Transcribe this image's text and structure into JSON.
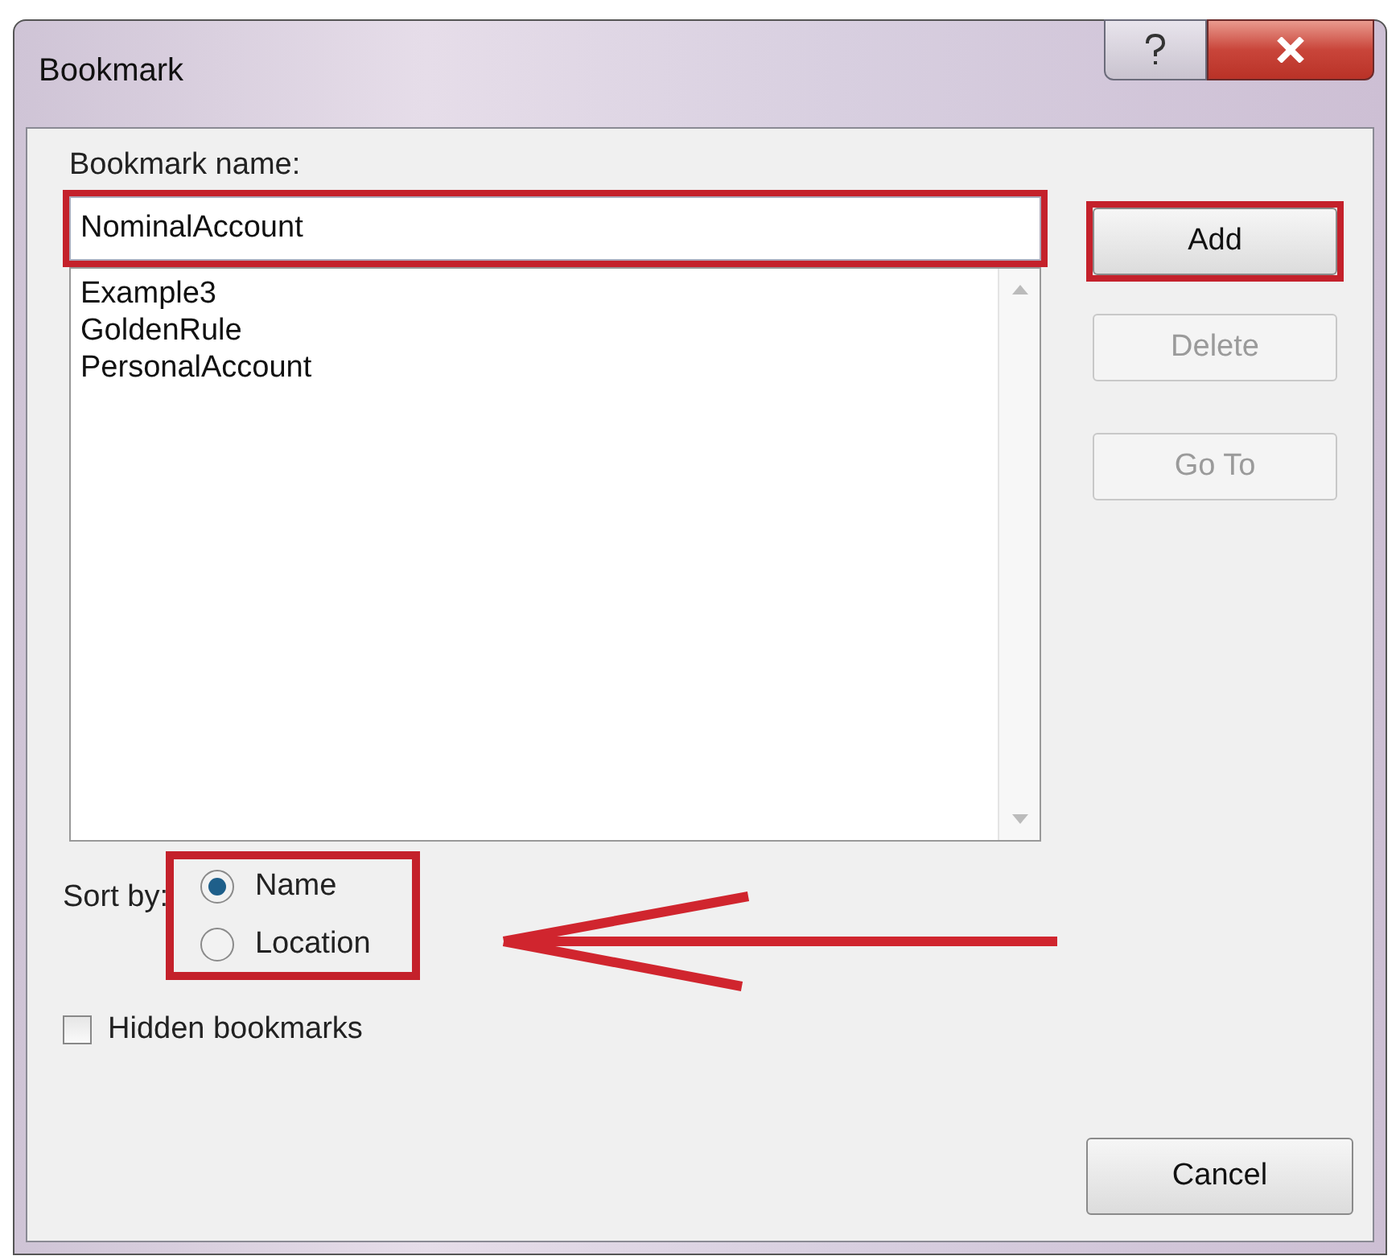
{
  "window": {
    "title": "Bookmark"
  },
  "name_field": {
    "label": "Bookmark name:",
    "value": "NominalAccount",
    "highlighted": true
  },
  "bookmarks": [
    "Example3",
    "GoldenRule",
    "PersonalAccount"
  ],
  "buttons": [
    {
      "label": "Add",
      "disabled": false,
      "highlighted": true
    },
    {
      "label": "Delete",
      "disabled": true,
      "highlighted": false
    },
    {
      "label": "Go To",
      "disabled": true,
      "highlighted": false
    }
  ],
  "sort": {
    "label": "Sort by:",
    "highlighted": true,
    "options": [
      {
        "label": "Name",
        "selected": true
      },
      {
        "label": "Location",
        "selected": false
      }
    ]
  },
  "hidden_bookmarks": {
    "label": "Hidden bookmarks",
    "checked": false
  },
  "cancel_button": {
    "label": "Cancel"
  }
}
